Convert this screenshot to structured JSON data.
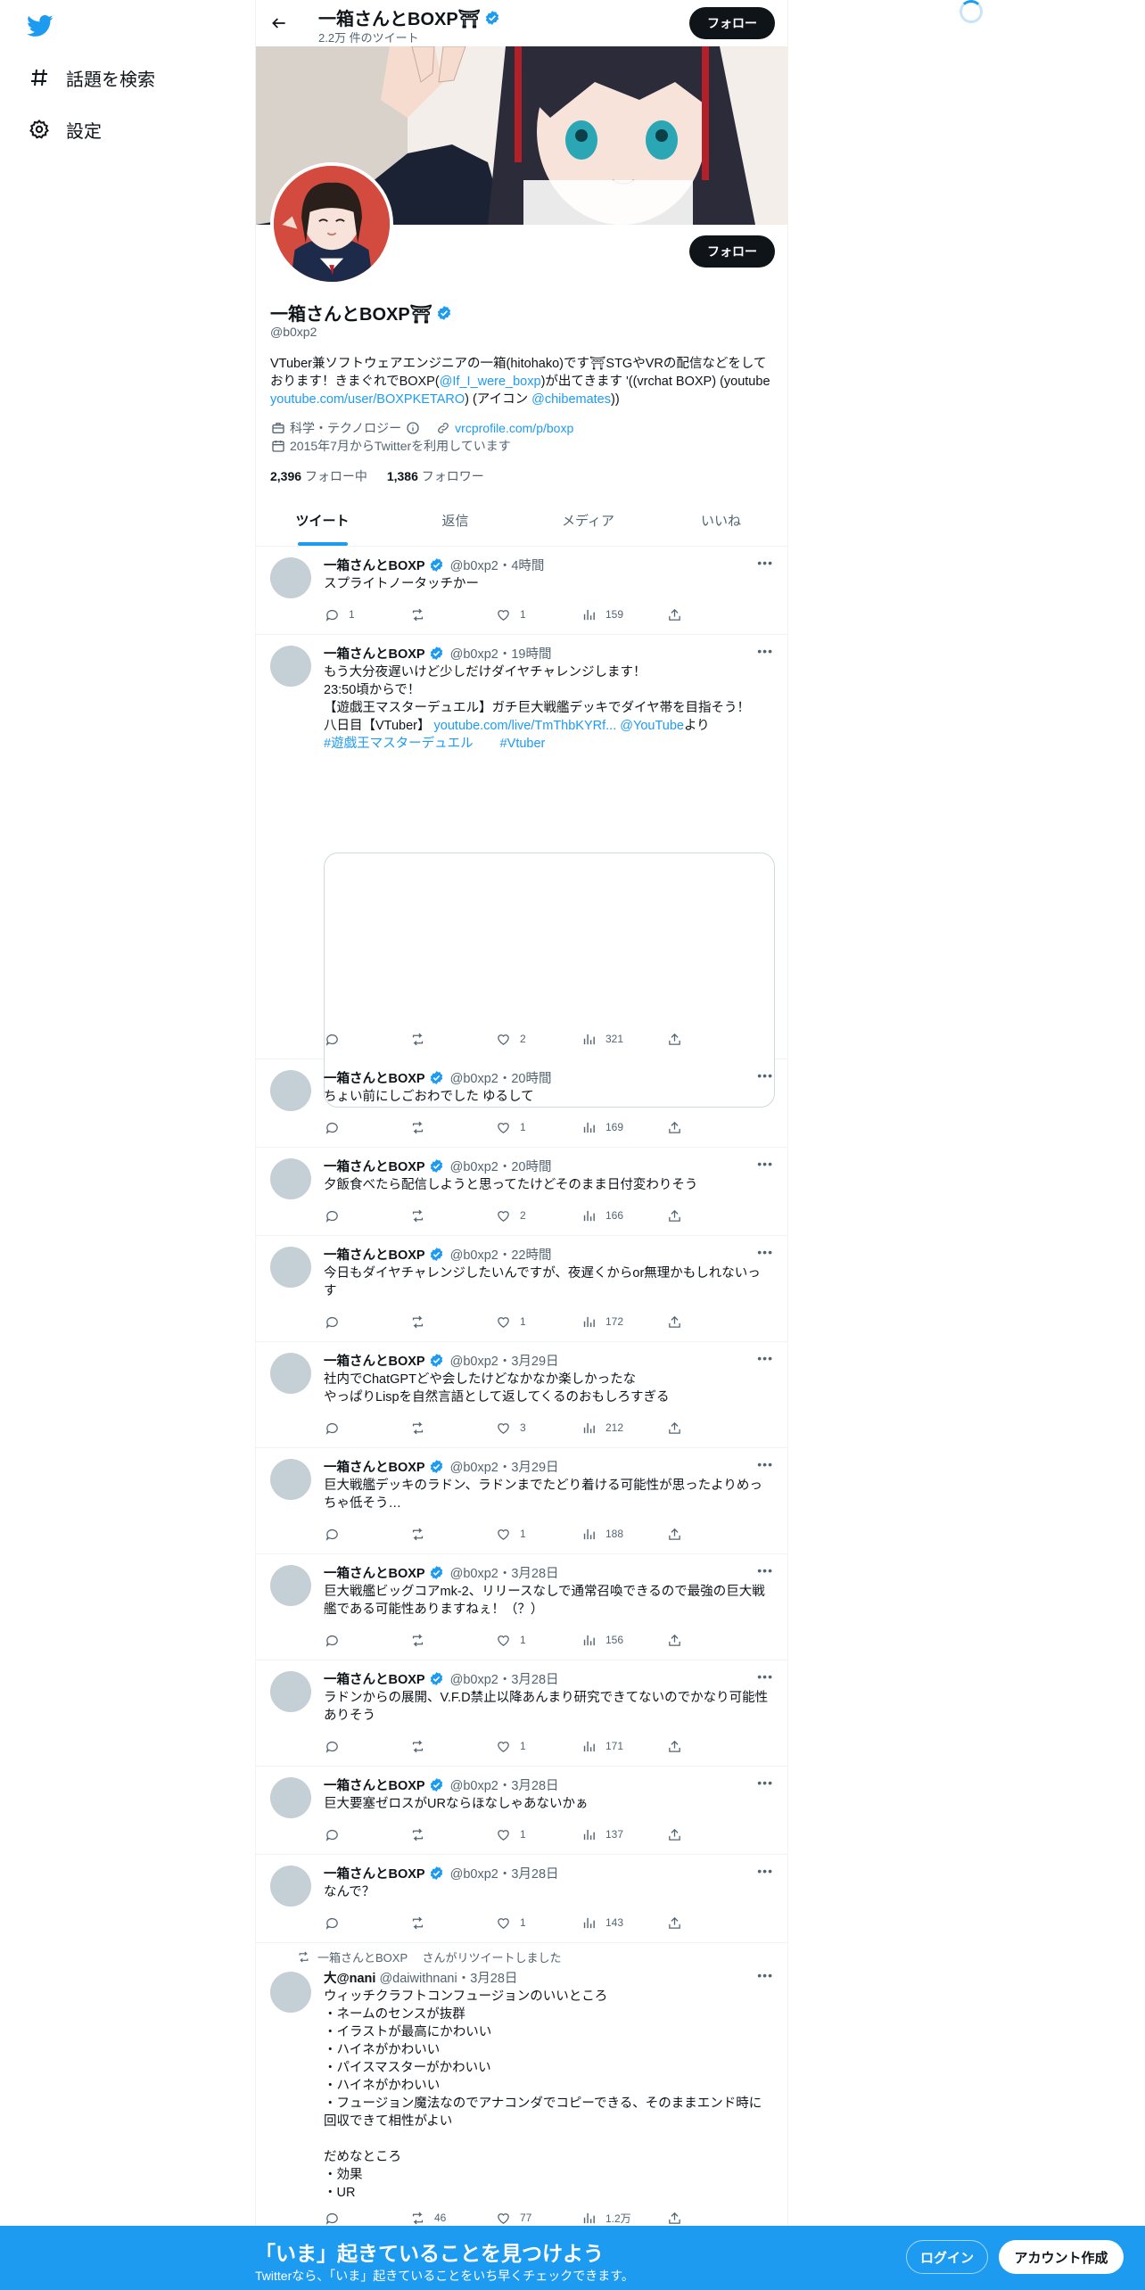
{
  "nav": {
    "items": [
      {
        "label": "話題を検索",
        "icon": "hashtag-icon"
      },
      {
        "label": "設定",
        "icon": "gear-icon"
      }
    ]
  },
  "header": {
    "name": "一箱さんとBOXP⛩",
    "tweet_count": "2.2万 件のツイート",
    "follow_label": "フォロー"
  },
  "profile": {
    "name": "一箱さんとBOXP⛩",
    "handle": "@b0xp2",
    "follow_label": "フォロー",
    "bio_part1": "VTuber兼ソフトウェアエンジニアの一箱(hitohako)です⛩STGやVRの配信などをしております！きまぐれでBOXP(",
    "bio_link1": "@If_I_were_boxp",
    "bio_part2": ")が出てきます '((vrchat BOXP) (youtube ",
    "bio_link2": "youtube.com/user/BOXPKETARO",
    "bio_part3": ") (アイコン ",
    "bio_link3": "@chibemates",
    "bio_part4": "))",
    "category": "科学・テクノロジー",
    "website": "vrcprofile.com/p/boxp",
    "joined": "2015年7月からTwitterを利用しています",
    "following_count": "2,396",
    "following_label": "フォロー中",
    "followers_count": "1,386",
    "followers_label": "フォロワー"
  },
  "tabs": [
    "ツイート",
    "返信",
    "メディア",
    "いいね"
  ],
  "tweets": [
    {
      "name": "一箱さんとBOXP",
      "meta": "@b0xp2・4時間",
      "text": "スプライトノータッチかー",
      "reply": "1",
      "retweet": "",
      "like": "1",
      "views": "159"
    },
    {
      "name": "一箱さんとBOXP",
      "meta": "@b0xp2・19時間",
      "text_line1": "もう大分夜遅いけど少しだけダイヤチャレンジします！",
      "text_line2": "23:50頃からで！",
      "text_line3": "【遊戯王マスターデュエル】ガチ巨大戦艦デッキでダイヤ帯を目指そう！",
      "text_line4_a": "八日目【VTuber】 ",
      "text_link1": "youtube.com/live/TmThbKYRf...",
      "text_link2": "@YouTube",
      "text_line4_b": "より",
      "hashtag1": "#遊戯王マスターデュエル",
      "hashtag2": "#Vtuber",
      "reply": "",
      "retweet": "",
      "like": "2",
      "views": "321"
    },
    {
      "name": "一箱さんとBOXP",
      "meta": "@b0xp2・20時間",
      "text": "ちょい前にしごおわでした ゆるして",
      "reply": "",
      "retweet": "",
      "like": "1",
      "views": "169"
    },
    {
      "name": "一箱さんとBOXP",
      "meta": "@b0xp2・20時間",
      "text": "夕飯食べたら配信しようと思ってたけどそのまま日付変わりそう",
      "reply": "",
      "retweet": "",
      "like": "2",
      "views": "166"
    },
    {
      "name": "一箱さんとBOXP",
      "meta": "@b0xp2・22時間",
      "text": "今日もダイヤチャレンジしたいんですが、夜遅くからor無理かもしれないっす",
      "reply": "",
      "retweet": "",
      "like": "1",
      "views": "172"
    },
    {
      "name": "一箱さんとBOXP",
      "meta": "@b0xp2・3月29日",
      "text": "社内でChatGPTどや会したけどなかなか楽しかったな\nやっぱりLispを自然言語として返してくるのおもしろすぎる",
      "reply": "",
      "retweet": "",
      "like": "3",
      "views": "212"
    },
    {
      "name": "一箱さんとBOXP",
      "meta": "@b0xp2・3月29日",
      "text": "巨大戦艦デッキのラドン、ラドンまでたどり着ける可能性が思ったよりめっちゃ低そう…",
      "reply": "",
      "retweet": "",
      "like": "1",
      "views": "188"
    },
    {
      "name": "一箱さんとBOXP",
      "meta": "@b0xp2・3月28日",
      "text": "巨大戦艦ビッグコアmk-2、リリースなしで通常召喚できるので最強の巨大戦艦である可能性ありますねぇ！（？）",
      "reply": "",
      "retweet": "",
      "like": "1",
      "views": "156"
    },
    {
      "name": "一箱さんとBOXP",
      "meta": "@b0xp2・3月28日",
      "text": "ラドンからの展開、V.F.D禁止以降あんまり研究できてないのでかなり可能性ありそう",
      "reply": "",
      "retweet": "",
      "like": "1",
      "views": "171"
    },
    {
      "name": "一箱さんとBOXP",
      "meta": "@b0xp2・3月28日",
      "text": "巨大要塞ゼロスがURならほなしゃあないかぁ",
      "reply": "",
      "retweet": "",
      "like": "1",
      "views": "137"
    },
    {
      "name": "一箱さんとBOXP",
      "meta": "@b0xp2・3月28日",
      "text": "なんで？",
      "reply": "",
      "retweet": "",
      "like": "1",
      "views": "143"
    },
    {
      "retweet_label": "一箱さんとBOXP　 さんがリツイートしました",
      "name": "大@nani",
      "meta": "@daiwithnani・3月28日",
      "text": "ウィッチクラフトコンフュージョンのいいところ\n・ネームのセンスが抜群\n・イラストが最高にかわいい\n・ハイネがかわいい\n・パイスマスターがかわいい\n・ハイネがかわいい\n・フュージョン魔法なのでアナコンダでコピーできる、そのままエンド時に回収できて相性がよい\n\nだめなところ\n・効果\n・UR",
      "reply": "",
      "retweet": "46",
      "like": "77",
      "views": "1.2万"
    }
  ],
  "bottom_bar": {
    "title": "「いま」起きていることを見つけよう",
    "subtitle": "Twitterなら、「いま」起きていることをいち早くチェックできます。",
    "login_label": "ログイン",
    "signup_label": "アカウント作成"
  },
  "colors": {
    "accent": "#1d9bf0",
    "text": "#0f1419",
    "muted": "#536471",
    "torii": "#e0245e"
  }
}
